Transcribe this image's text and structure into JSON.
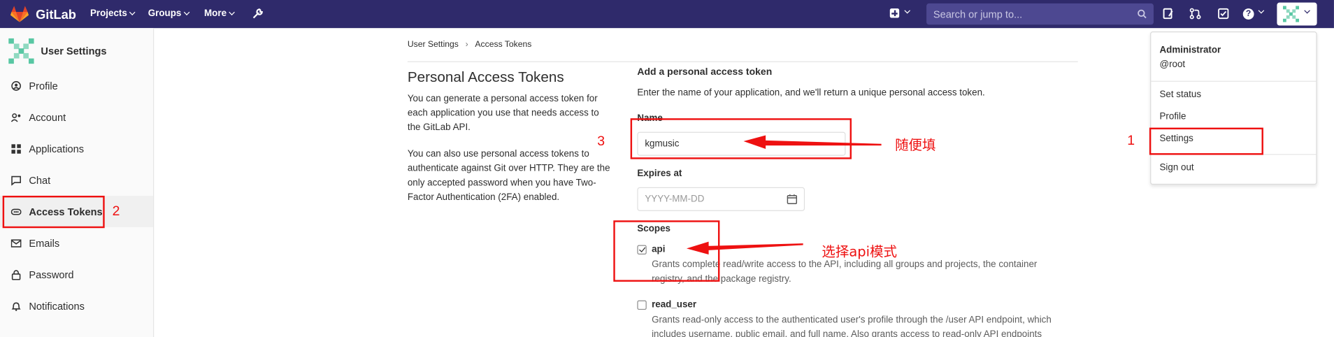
{
  "navbar": {
    "brand": "GitLab",
    "menu": [
      "Projects",
      "Groups",
      "More"
    ],
    "search_placeholder": "Search or jump to..."
  },
  "sidebar": {
    "title": "User Settings",
    "items": [
      {
        "label": "Profile",
        "icon": "profile-icon"
      },
      {
        "label": "Account",
        "icon": "account-icon"
      },
      {
        "label": "Applications",
        "icon": "applications-icon"
      },
      {
        "label": "Chat",
        "icon": "chat-icon"
      },
      {
        "label": "Access Tokens",
        "icon": "token-icon"
      },
      {
        "label": "Emails",
        "icon": "envelope-icon"
      },
      {
        "label": "Password",
        "icon": "lock-icon"
      },
      {
        "label": "Notifications",
        "icon": "bell-icon"
      }
    ]
  },
  "breadcrumb": [
    "User Settings",
    "Access Tokens"
  ],
  "main": {
    "title": "Personal Access Tokens",
    "desc1": [
      "You can generate a personal access token for",
      "each application you use that needs access to",
      "the GitLab API."
    ],
    "desc2": [
      "You can also use personal access tokens to",
      "authenticate against Git over HTTP. They are the",
      "only accepted password when you have Two-",
      "Factor Authentication (2FA) enabled."
    ],
    "form": {
      "heading": "Add a personal access token",
      "subheading": "Enter the name of your application, and we'll return a unique personal access token.",
      "name_label": "Name",
      "name_value": "kgmusic",
      "expires_label": "Expires at",
      "expires_placeholder": "YYYY-MM-DD",
      "scopes_label": "Scopes",
      "scopes": [
        {
          "name": "api",
          "checked": true,
          "desc": [
            "Grants complete read/write access to the API, including all groups and projects, the container",
            "registry, and the package registry."
          ]
        },
        {
          "name": "read_user",
          "checked": false,
          "desc": [
            "Grants read-only access to the authenticated user's profile through the /user API endpoint, which",
            "includes username, public email, and full name. Also grants access to read-only API endpoints"
          ]
        }
      ]
    }
  },
  "user_dropdown": {
    "name": "Administrator",
    "username": "@root",
    "items": [
      "Set status",
      "Profile",
      "Settings",
      "Sign out"
    ]
  },
  "annotations": {
    "n1": "1",
    "n2": "2",
    "n3": "3",
    "name_note": "随便填",
    "scope_note": "选择api模式"
  },
  "colors": {
    "navbar": "#2f2a6b",
    "annotation": "#ee1111"
  }
}
